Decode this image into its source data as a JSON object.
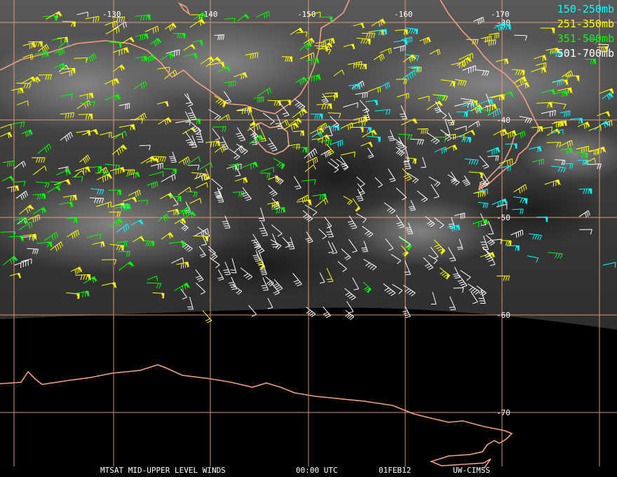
{
  "legend": [
    {
      "label": "150-250mb",
      "color": "#00ffff"
    },
    {
      "label": "251-350mb",
      "color": "#ffff00"
    },
    {
      "label": "351-500mb",
      "color": "#00ff00"
    },
    {
      "label": "501-700mb",
      "color": "#ffffff"
    }
  ],
  "graticule": {
    "longitudes": [
      "-130",
      "-140",
      "-150",
      "-160",
      "-170"
    ],
    "latitudes": [
      "-30",
      "-40",
      "-50",
      "-60",
      "-70"
    ],
    "color": "#f0a080"
  },
  "coastline_color": "#f0a080",
  "footer": {
    "title": "MTSAT MID-UPPER LEVEL WINDS",
    "time": "00:00 UTC",
    "date": "01FEB12",
    "source": "UW-CIMSS"
  }
}
